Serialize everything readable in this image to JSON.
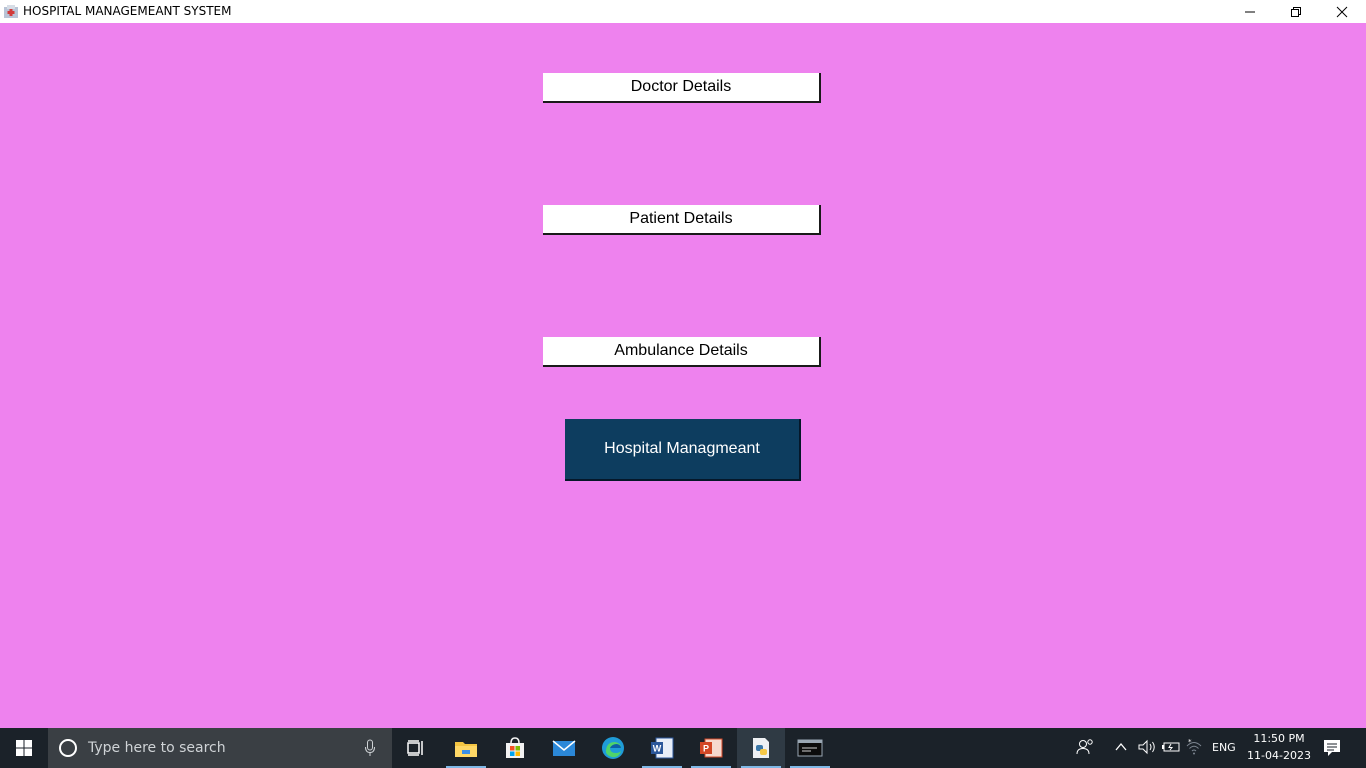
{
  "window": {
    "title": "HOSPITAL MANAGEMEANT SYSTEM",
    "background": "#ee82ee"
  },
  "menu": {
    "doctor_details": "Doctor Details",
    "patient_details": "Patient Details",
    "ambulance_details": "Ambulance Details",
    "hospital_managmeant": "Hospital Managmeant"
  },
  "taskbar": {
    "search_placeholder": "Type here to search",
    "apps": [
      "task-view-icon",
      "file-explorer-icon",
      "microsoft-store-icon",
      "mail-icon",
      "edge-icon",
      "word-icon",
      "powerpoint-icon",
      "python-icon",
      "terminal-icon"
    ],
    "language": "ENG",
    "time": "11:50 PM",
    "date": "11-04-2023"
  }
}
